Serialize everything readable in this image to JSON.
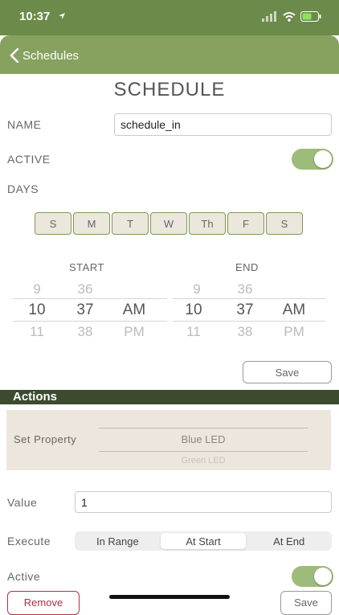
{
  "status": {
    "time": "10:37"
  },
  "nav": {
    "back_label": "Schedules"
  },
  "page_title": "SCHEDULE",
  "name": {
    "label": "NAME",
    "value": "schedule_in"
  },
  "active": {
    "label": "ACTIVE",
    "on": true
  },
  "days": {
    "label": "DAYS",
    "items": [
      "S",
      "M",
      "T",
      "W",
      "Th",
      "F",
      "S"
    ]
  },
  "start": {
    "label": "START",
    "hour_prev": "9",
    "hour": "10",
    "hour_next": "11",
    "min_prev": "36",
    "min": "37",
    "min_next": "38",
    "ampm": "AM",
    "ampm_next": "PM"
  },
  "end": {
    "label": "END",
    "hour_prev": "9",
    "hour": "10",
    "hour_next": "11",
    "min_prev": "36",
    "min": "37",
    "min_next": "38",
    "ampm": "AM",
    "ampm_next": "PM"
  },
  "save_label": "Save",
  "actions": {
    "header": "Actions",
    "set_property_label": "Set Property",
    "property_options": [
      "Blue LED",
      "Green LED"
    ],
    "value_label": "Value",
    "value": "1",
    "execute_label": "Execute",
    "execute_options": [
      "In Range",
      "At Start",
      "At End"
    ],
    "execute_selected": "At Start",
    "active_label": "Active",
    "active_on": true,
    "remove_label": "Remove",
    "save_label": "Save"
  },
  "colors": {
    "nav_bg": "#87a15f",
    "toggle_on": "#9dbb7a",
    "actions_bar": "#3c4a2e",
    "day_border": "#7c9a55",
    "remove_border": "#b03040"
  }
}
